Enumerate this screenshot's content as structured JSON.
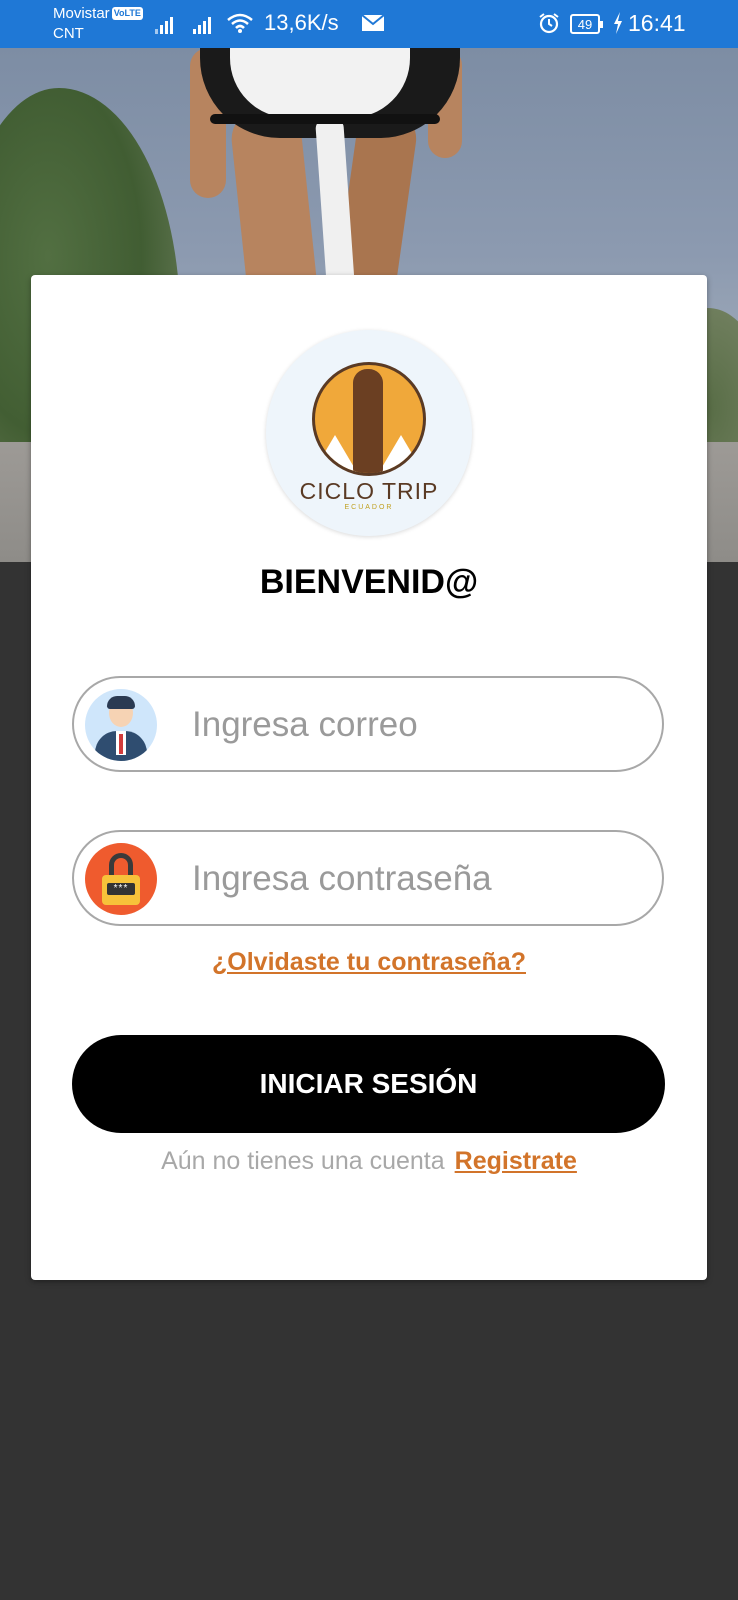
{
  "status_bar": {
    "carrier_line1": "Movistar",
    "volte_badge": "VoLTE",
    "carrier_line2": "CNT",
    "net_speed": "13,6K/s",
    "battery_level": "49",
    "time": "16:41"
  },
  "logo": {
    "name": "CICLO TRIP",
    "subtitle": "ECUADOR"
  },
  "welcome_title": "BIENVENID@",
  "email_input": {
    "placeholder": "Ingresa correo",
    "value": ""
  },
  "password_input": {
    "placeholder": "Ingresa contraseña",
    "value": ""
  },
  "forgot_password_link": "¿Olvidaste tu contraseña?",
  "login_button": "INICIAR SESIÓN",
  "register": {
    "prompt": "Aún no tienes una cuenta",
    "link": "Registrate"
  },
  "colors": {
    "status_bar": "#1f78d6",
    "accent_link": "#d2742a",
    "button": "#000000",
    "background": "#333333"
  }
}
